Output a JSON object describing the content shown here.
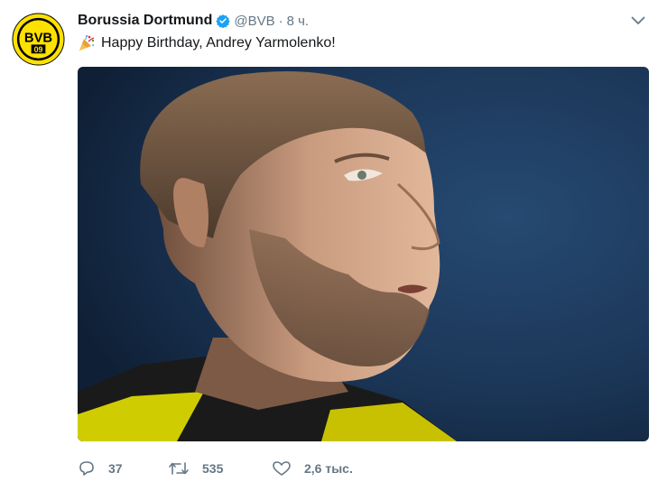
{
  "tweet": {
    "author_name": "Borussia Dortmund",
    "handle": "@BVB",
    "separator": "·",
    "time": "8 ч.",
    "text": "Happy Birthday, Andrey Yarmolenko!",
    "avatar_logo_text": "BVB 09",
    "media_description_icon": "player-photo",
    "stats": {
      "replies": "37",
      "retweets": "535",
      "likes": "2,6 тыс."
    }
  },
  "colors": {
    "brand_yellow": "#fde100",
    "verified_blue": "#1da1f2",
    "muted": "#657786",
    "photo_background": "#1d3a5c"
  }
}
